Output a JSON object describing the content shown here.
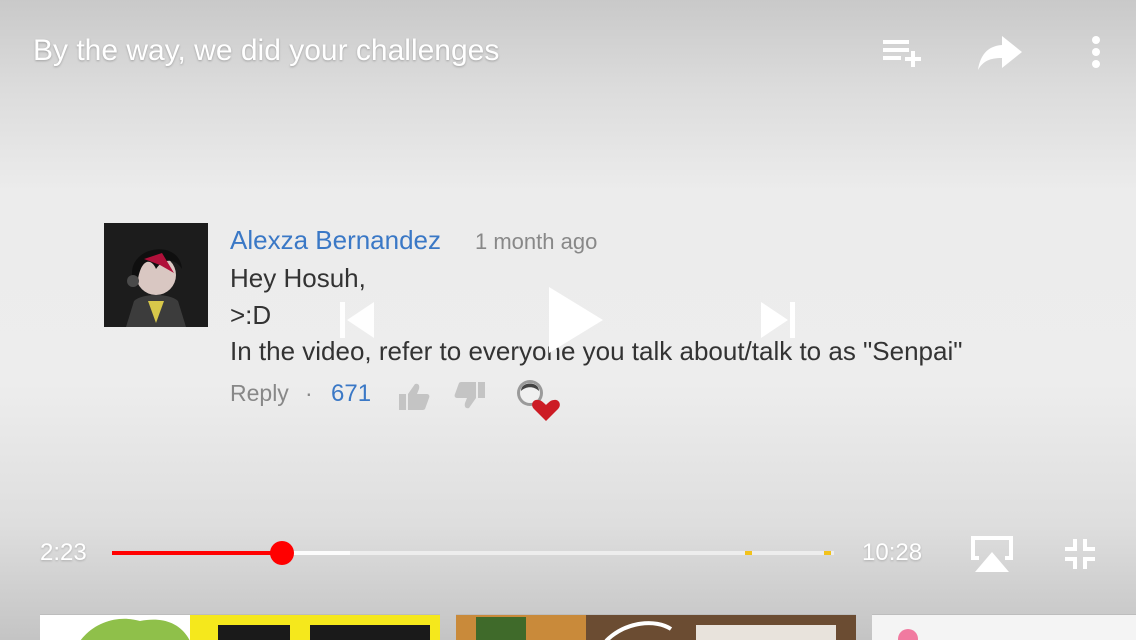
{
  "video": {
    "title": "By the way, we did your challenges"
  },
  "top_actions": {
    "add_to_playlist_icon": "playlist-add-icon",
    "share_icon": "share-icon",
    "more_icon": "more-vert-icon"
  },
  "comment": {
    "author": "Alexza Bernandez",
    "time": "1 month ago",
    "lines": [
      "Hey Hosuh,",
      ">:D",
      "In the video, refer to everyone you talk about/talk to as \"Senpai\""
    ],
    "reply_label": "Reply",
    "separator": "·",
    "likes": "671",
    "heart_color": "#cc1b24"
  },
  "playback": {
    "current_time": "2:23",
    "duration": "10:28",
    "progress_fraction": 0.2356,
    "buffered_fraction": 0.33,
    "ad_markers_fraction": [
      0.882,
      0.992
    ],
    "accent_color": "#ff0000",
    "ad_marker_color": "#f2c21b"
  },
  "controls": {
    "previous_icon": "skip-previous-icon",
    "play_icon": "play-icon",
    "next_icon": "skip-next-icon",
    "airplay_icon": "airplay-icon",
    "exit_fullscreen_icon": "fullscreen-exit-icon"
  }
}
